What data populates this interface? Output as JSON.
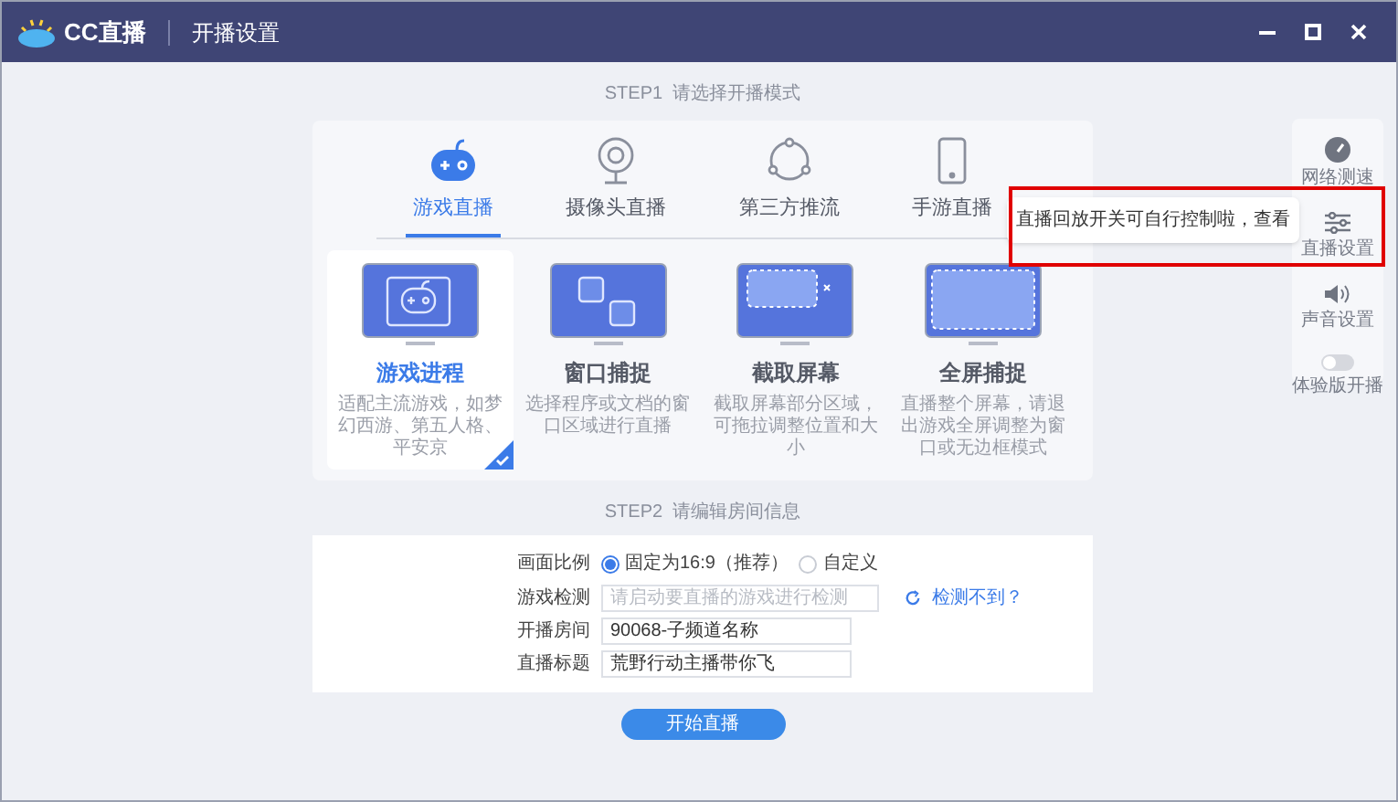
{
  "window": {
    "logo": "CC直播",
    "title": "开播设置"
  },
  "step1": {
    "label": "STEP1  请选择开播模式",
    "tabs": [
      {
        "label": "游戏直播",
        "selected": true,
        "kind": "gamepad"
      },
      {
        "label": "摄像头直播",
        "selected": false,
        "kind": "webcam"
      },
      {
        "label": "第三方推流",
        "selected": false,
        "kind": "share"
      },
      {
        "label": "手游直播",
        "selected": false,
        "kind": "phone"
      }
    ],
    "cards": [
      {
        "title": "游戏进程",
        "description": "适配主流游戏，如梦幻西游、第五人格、平安京",
        "selected": true,
        "kind": "game"
      },
      {
        "title": "窗口捕捉",
        "description": "选择程序或文档的窗口区域进行直播",
        "selected": false,
        "kind": "window"
      },
      {
        "title": "截取屏幕",
        "description": "截取屏幕部分区域，可拖拉调整位置和大小",
        "selected": false,
        "kind": "region"
      },
      {
        "title": "全屏捕捉",
        "description": "直播整个屏幕，请退出游戏全屏调整为窗口或无边框模式",
        "selected": false,
        "kind": "full"
      }
    ]
  },
  "step2": {
    "label": "STEP2  请编辑房间信息",
    "ratio": {
      "label": "画面比例",
      "options": [
        {
          "label": "固定为16:9（推荐）",
          "selected": true
        },
        {
          "label": "自定义",
          "selected": false
        }
      ]
    },
    "game_detect": {
      "label": "游戏检测",
      "placeholder": "请启动要直播的游戏进行检测",
      "link": "检测不到？"
    },
    "room": {
      "label": "开播房间",
      "value": "90068-子频道名称"
    },
    "stream_title": {
      "label": "直播标题",
      "value": "荒野行动主播带你飞"
    },
    "start_button": "开始直播"
  },
  "sidebar": {
    "items": [
      {
        "label": "网络测速",
        "kind": "speed"
      },
      {
        "label": "直播设置",
        "kind": "settings"
      },
      {
        "label": "声音设置",
        "kind": "sound"
      },
      {
        "label": "体验版开播",
        "kind": "toggle",
        "on": false
      }
    ]
  },
  "tooltip": "直播回放开关可自行控制啦，查看"
}
